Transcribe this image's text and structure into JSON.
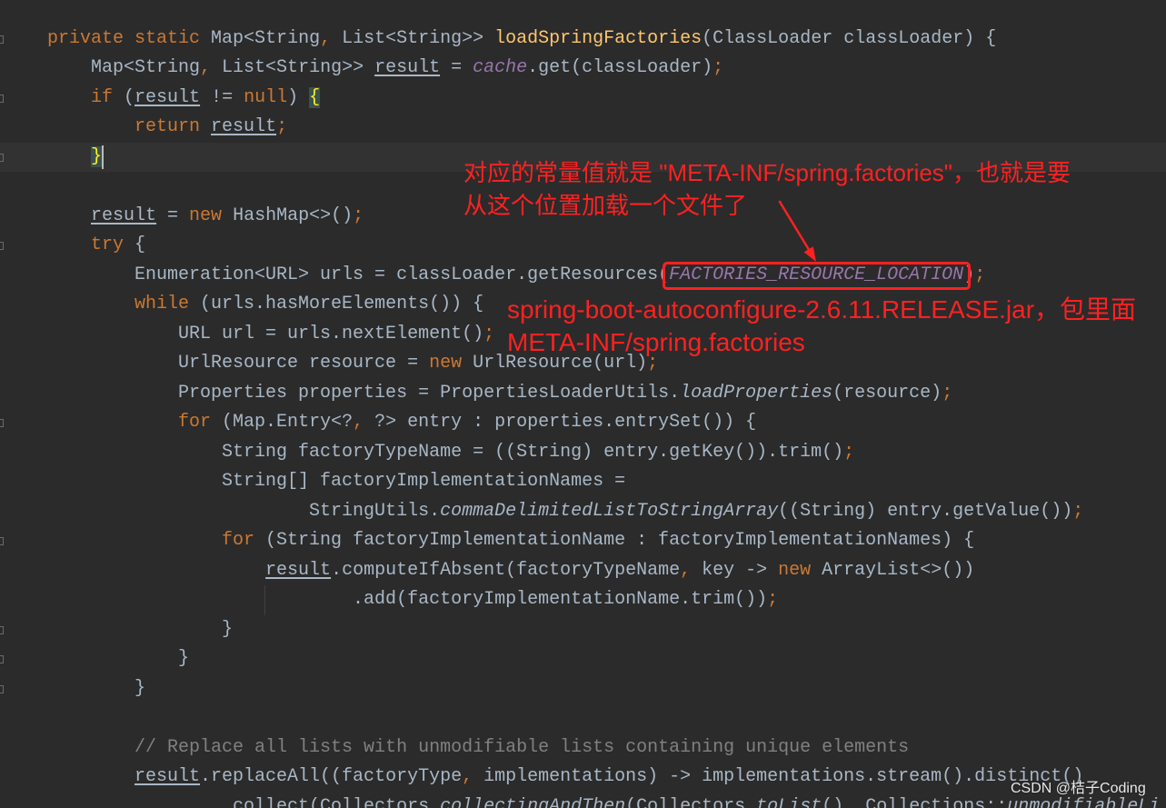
{
  "editor": {
    "background": "#2B2B2B",
    "text_color": "#A9B7C6",
    "current_line_color": "#323232",
    "caret_color": "#BBBBBB",
    "lines": [
      [
        {
          "t": "private",
          "c": "#CC7832"
        },
        {
          "t": " "
        },
        {
          "t": "static",
          "c": "#CC7832"
        },
        {
          "t": " Map<String"
        },
        {
          "t": ",",
          "c": "#CC7832"
        },
        {
          "t": " List<String>> "
        },
        {
          "t": "loadSpringFactories",
          "c": "#FFC66D"
        },
        {
          "t": "(ClassLoader classLoader) {"
        }
      ],
      [
        {
          "t": "    Map<String"
        },
        {
          "t": ",",
          "c": "#CC7832"
        },
        {
          "t": " List<String>> "
        },
        {
          "t": "result",
          "u": true
        },
        {
          "t": " = "
        },
        {
          "t": "cache",
          "c": "#9876AA",
          "i": true
        },
        {
          "t": ".get(classLoader)"
        },
        {
          "t": ";",
          "c": "#CC7832"
        }
      ],
      [
        {
          "t": "    "
        },
        {
          "t": "if",
          "c": "#CC7832"
        },
        {
          "t": " ("
        },
        {
          "t": "result",
          "u": true
        },
        {
          "t": " != "
        },
        {
          "t": "null",
          "c": "#CC7832"
        },
        {
          "t": ") "
        },
        {
          "t": "{",
          "c": "#FFEF28",
          "bg": "#3B514D"
        }
      ],
      [
        {
          "t": "        "
        },
        {
          "t": "return",
          "c": "#CC7832"
        },
        {
          "t": " "
        },
        {
          "t": "result",
          "u": true
        },
        {
          "t": ";",
          "c": "#CC7832"
        }
      ],
      [
        {
          "t": "    "
        },
        {
          "t": "}",
          "c": "#FFEF28",
          "bg": "#3B514D"
        }
      ],
      [],
      [
        {
          "t": "    "
        },
        {
          "t": "result",
          "u": true
        },
        {
          "t": " = "
        },
        {
          "t": "new",
          "c": "#CC7832"
        },
        {
          "t": " HashMap<>()"
        },
        {
          "t": ";",
          "c": "#CC7832"
        }
      ],
      [
        {
          "t": "    "
        },
        {
          "t": "try",
          "c": "#CC7832"
        },
        {
          "t": " {"
        }
      ],
      [
        {
          "t": "        Enumeration<URL> urls = classLoader.getResources("
        },
        {
          "t": "FACTORIES_RESOURCE_LOCATION",
          "c": "#9876AA",
          "i": true
        },
        {
          "t": ")"
        },
        {
          "t": ";",
          "c": "#CC7832"
        }
      ],
      [
        {
          "t": "        "
        },
        {
          "t": "while",
          "c": "#CC7832"
        },
        {
          "t": " (urls.hasMoreElements()) {"
        }
      ],
      [
        {
          "t": "            URL url = urls.nextElement()"
        },
        {
          "t": ";",
          "c": "#CC7832"
        }
      ],
      [
        {
          "t": "            UrlResource resource = "
        },
        {
          "t": "new",
          "c": "#CC7832"
        },
        {
          "t": " UrlResource(url)"
        },
        {
          "t": ";",
          "c": "#CC7832"
        }
      ],
      [
        {
          "t": "            Properties properties = PropertiesLoaderUtils."
        },
        {
          "t": "loadProperties",
          "i": true
        },
        {
          "t": "(resource)"
        },
        {
          "t": ";",
          "c": "#CC7832"
        }
      ],
      [
        {
          "t": "            "
        },
        {
          "t": "for",
          "c": "#CC7832"
        },
        {
          "t": " (Map.Entry<?"
        },
        {
          "t": ",",
          "c": "#CC7832"
        },
        {
          "t": " ?> entry : properties.entrySet()) {"
        }
      ],
      [
        {
          "t": "                String factoryTypeName = ((String) entry.getKey()).trim()"
        },
        {
          "t": ";",
          "c": "#CC7832"
        }
      ],
      [
        {
          "t": "                String[] factoryImplementationNames ="
        }
      ],
      [
        {
          "t": "                        StringUtils."
        },
        {
          "t": "commaDelimitedListToStringArray",
          "i": true
        },
        {
          "t": "((String) entry.getValue())"
        },
        {
          "t": ";",
          "c": "#CC7832"
        }
      ],
      [
        {
          "t": "                "
        },
        {
          "t": "for",
          "c": "#CC7832"
        },
        {
          "t": " (String factoryImplementationName : factoryImplementationNames) {"
        }
      ],
      [
        {
          "t": "                    "
        },
        {
          "t": "result",
          "u": true
        },
        {
          "t": ".computeIfAbsent(factoryTypeName"
        },
        {
          "t": ",",
          "c": "#CC7832"
        },
        {
          "t": " key -> "
        },
        {
          "t": "new",
          "c": "#CC7832"
        },
        {
          "t": " ArrayList<>())"
        }
      ],
      [
        {
          "t": "                            .add(factoryImplementationName.trim())"
        },
        {
          "t": ";",
          "c": "#CC7832"
        }
      ],
      [
        {
          "t": "                }"
        }
      ],
      [
        {
          "t": "            }"
        }
      ],
      [
        {
          "t": "        }"
        }
      ],
      [],
      [
        {
          "t": "        "
        },
        {
          "t": "// Replace all lists with unmodifiable lists containing unique elements",
          "c": "#808080"
        }
      ],
      [
        {
          "t": "        "
        },
        {
          "t": "result",
          "u": true
        },
        {
          "t": ".replaceAll((factoryType"
        },
        {
          "t": ",",
          "c": "#CC7832"
        },
        {
          "t": " implementations) -> implementations.stream().distinct()"
        }
      ],
      [
        {
          "t": "                .collect(Collectors."
        },
        {
          "t": "collectingAndThen",
          "i": true
        },
        {
          "t": "(Collectors."
        },
        {
          "t": "toList",
          "i": true
        },
        {
          "t": "()"
        },
        {
          "t": ",",
          "c": "#CC7832"
        },
        {
          "t": " Collections::"
        },
        {
          "t": "unmodifiableLi",
          "i": true
        }
      ]
    ]
  },
  "annotations": {
    "color": "#FF2121",
    "constant_note": [
      "对应的常量值就是 \"META-INF/spring.factories\"，也就是要",
      "从这个位置加载一个文件了"
    ],
    "jar_note": [
      "spring-boot-autoconfigure-2.6.11.RELEASE.jar，包里面",
      "META-INF/spring.factories"
    ]
  },
  "watermark": "CSDN @桔子Coding"
}
